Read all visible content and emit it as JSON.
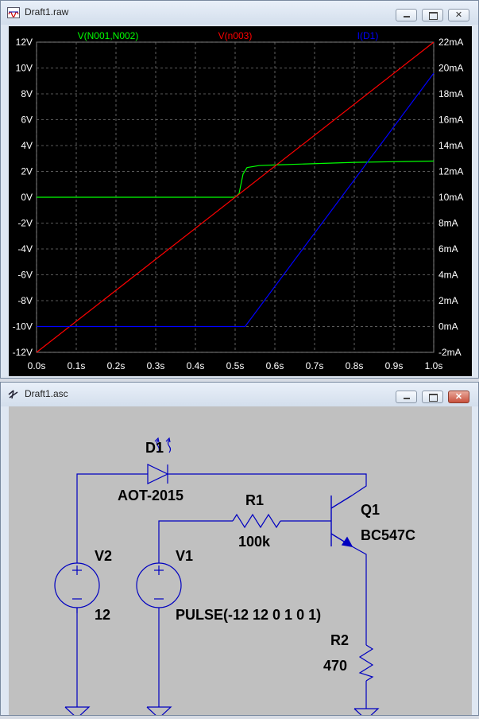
{
  "waveform_window": {
    "title": "Draft1.raw",
    "buttons": {
      "minimize": "minimize",
      "maximize": "maximize",
      "close": "close"
    }
  },
  "schematic_window": {
    "title": "Draft1.asc",
    "buttons": {
      "minimize": "minimize",
      "maximize": "maximize",
      "close": "close"
    }
  },
  "chart_data": {
    "type": "line",
    "xlabel": "",
    "ylabel": "",
    "x_ticks": [
      "0.0s",
      "0.1s",
      "0.2s",
      "0.3s",
      "0.4s",
      "0.5s",
      "0.6s",
      "0.7s",
      "0.8s",
      "0.9s",
      "1.0s"
    ],
    "y_left_ticks": [
      "12V",
      "10V",
      "8V",
      "6V",
      "4V",
      "2V",
      "0V",
      "-2V",
      "-4V",
      "-6V",
      "-8V",
      "-10V",
      "-12V"
    ],
    "y_right_ticks": [
      "22mA",
      "20mA",
      "18mA",
      "16mA",
      "14mA",
      "12mA",
      "10mA",
      "8mA",
      "6mA",
      "4mA",
      "2mA",
      "0mA",
      "-2mA"
    ],
    "xlim": [
      0,
      1.0
    ],
    "ylim_left": [
      -12,
      12
    ],
    "ylim_right": [
      -2,
      22
    ],
    "grid": true,
    "series": [
      {
        "name": "V(N001,N002)",
        "color": "#00ff00",
        "axis": "left",
        "x": [
          0,
          0.5,
          0.51,
          0.52,
          0.53,
          0.56,
          0.6,
          0.7,
          0.8,
          0.9,
          1.0
        ],
        "y": [
          0,
          0,
          0.3,
          1.8,
          2.3,
          2.45,
          2.5,
          2.6,
          2.7,
          2.75,
          2.8
        ]
      },
      {
        "name": "V(n003)",
        "color": "#ff0000",
        "axis": "left",
        "x": [
          0,
          1.0
        ],
        "y": [
          -12,
          12
        ]
      },
      {
        "name": "I(D1)",
        "color": "#0000ff",
        "axis": "right",
        "x": [
          0,
          0.525,
          1.0
        ],
        "y": [
          0,
          0,
          19.6
        ]
      }
    ]
  },
  "schematic": {
    "components": {
      "d1": {
        "ref": "D1",
        "value": "AOT-2015"
      },
      "r1": {
        "ref": "R1",
        "value": "100k"
      },
      "q1": {
        "ref": "Q1",
        "value": "BC547C"
      },
      "v2": {
        "ref": "V2",
        "value": "12"
      },
      "v1": {
        "ref": "V1",
        "value": "PULSE(-12 12 0 1 0 1)"
      },
      "r2": {
        "ref": "R2",
        "value": "470"
      }
    },
    "wire_color": "#0000c0"
  }
}
